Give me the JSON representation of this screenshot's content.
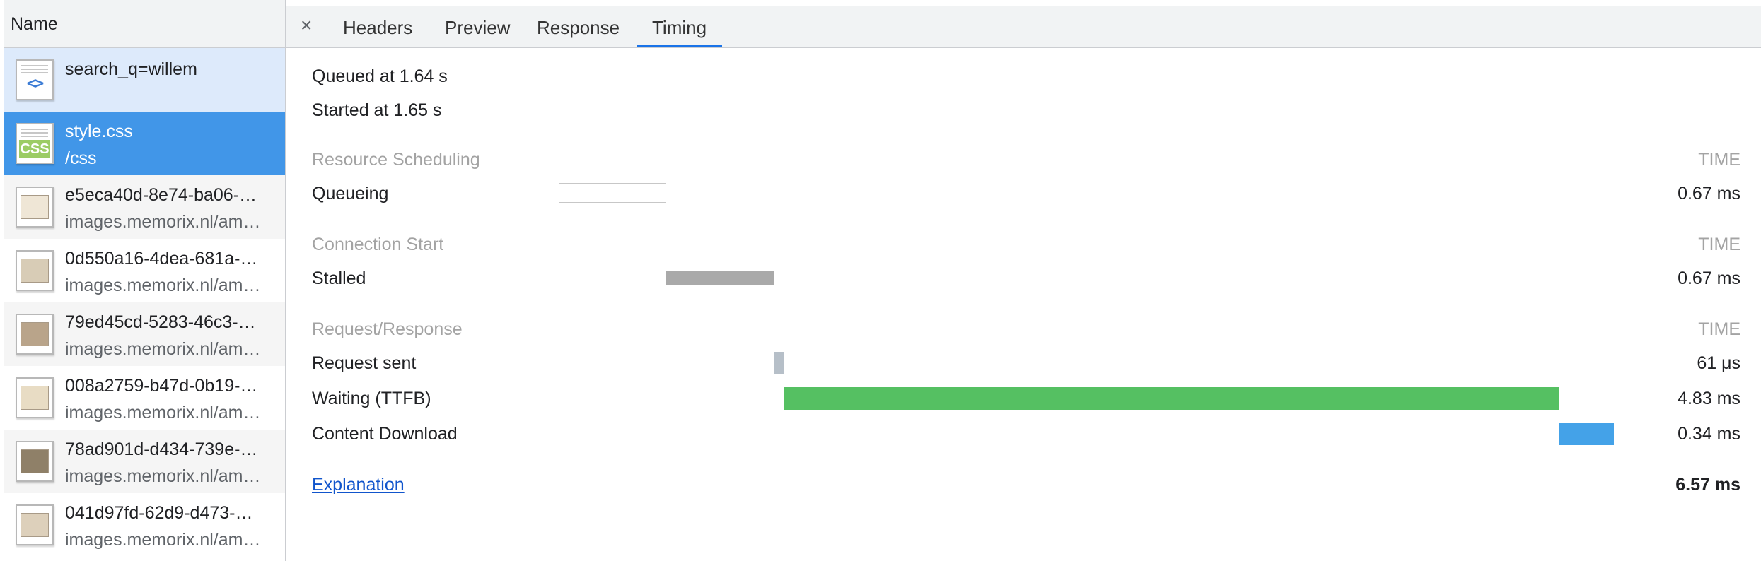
{
  "left_panel": {
    "header": "Name",
    "requests": [
      {
        "name": "search_q=willem",
        "sub": "",
        "icon": "html-icon"
      },
      {
        "name": "style.css",
        "sub": "/css",
        "icon": "css-icon"
      },
      {
        "name": "e5eca40d-8e74-ba06-…",
        "sub": "images.memorix.nl/am…",
        "icon": "image-icon"
      },
      {
        "name": "0d550a16-4dea-681a-…",
        "sub": "images.memorix.nl/am…",
        "icon": "image-icon"
      },
      {
        "name": "79ed45cd-5283-46c3-…",
        "sub": "images.memorix.nl/am…",
        "icon": "image-icon"
      },
      {
        "name": "008a2759-b47d-0b19-…",
        "sub": "images.memorix.nl/am…",
        "icon": "image-icon"
      },
      {
        "name": "78ad901d-d434-739e-…",
        "sub": "images.memorix.nl/am…",
        "icon": "image-icon"
      },
      {
        "name": "041d97fd-62d9-d473-…",
        "sub": "images.memorix.nl/am…",
        "icon": "image-icon"
      }
    ]
  },
  "tabs": {
    "close": "×",
    "items": [
      "Headers",
      "Preview",
      "Response",
      "Timing"
    ],
    "active": "Timing"
  },
  "timing": {
    "queued": "Queued at 1.64 s",
    "started": "Started at 1.65 s",
    "time_header": "TIME",
    "sections": {
      "scheduling": "Resource Scheduling",
      "connection": "Connection Start",
      "request": "Request/Response"
    },
    "rows": {
      "queueing": {
        "label": "Queueing",
        "value": "0.67 ms"
      },
      "stalled": {
        "label": "Stalled",
        "value": "0.67 ms"
      },
      "request_sent": {
        "label": "Request sent",
        "value": "61 μs"
      },
      "waiting": {
        "label": "Waiting (TTFB)",
        "value": "4.83 ms"
      },
      "download": {
        "label": "Content Download",
        "value": "0.34 ms"
      }
    },
    "explanation": "Explanation",
    "total": "6.57 ms",
    "colors": {
      "queueing": "#ffffff",
      "stalled": "#a9a9a9",
      "request_sent": "#b6bfc8",
      "waiting": "#55c062",
      "download": "#44a2e8",
      "selected_row": "#4196e8"
    }
  }
}
